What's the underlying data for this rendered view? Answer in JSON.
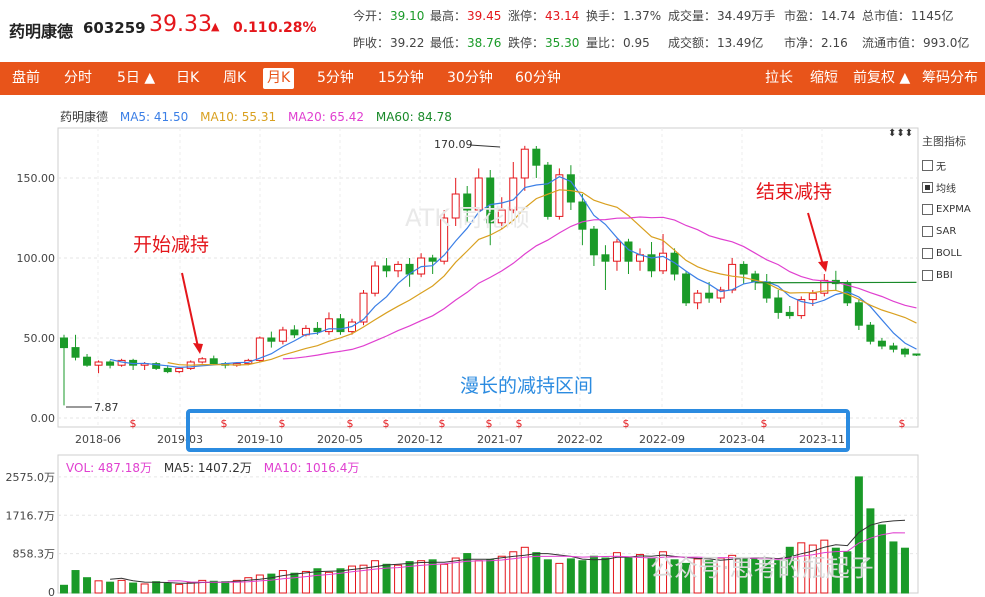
{
  "header": {
    "name": "药明康德",
    "code": "603259",
    "price": "39.33",
    "change": "0.11",
    "change_pct": "0.28%",
    "stats_row1": [
      {
        "label": "今开：",
        "value": "39.10",
        "color": "green"
      },
      {
        "label": "最高：",
        "value": "39.45",
        "color": "red"
      },
      {
        "label": "涨停：",
        "value": "43.14",
        "color": "red"
      },
      {
        "label": "换手：",
        "value": "1.37%",
        "color": ""
      },
      {
        "label": "成交量：",
        "value": "34.49万手",
        "color": ""
      },
      {
        "label": "市盈：",
        "value": "14.74",
        "color": ""
      },
      {
        "label": "总市值：",
        "value": "1145亿",
        "color": ""
      }
    ],
    "stats_row2": [
      {
        "label": "昨收：",
        "value": "39.22",
        "color": ""
      },
      {
        "label": "最低：",
        "value": "38.76",
        "color": "green"
      },
      {
        "label": "跌停：",
        "value": "35.30",
        "color": "green"
      },
      {
        "label": "量比：",
        "value": "0.95",
        "color": ""
      },
      {
        "label": "成交额：",
        "value": "13.49亿",
        "color": ""
      },
      {
        "label": "市净：",
        "value": "2.16",
        "color": ""
      },
      {
        "label": "流通市值：",
        "value": "993.0亿",
        "color": ""
      }
    ]
  },
  "tabs": {
    "left": [
      "盘前",
      "分时",
      "5日 ▲",
      "日K",
      "周K",
      "月K",
      "5分钟",
      "15分钟",
      "30分钟",
      "60分钟"
    ],
    "active": "月K",
    "right": [
      "拉长",
      "缩短",
      "前复权 ▲",
      "筹码分布"
    ]
  },
  "legend": {
    "name": "药明康德",
    "ma5": "MA5: 41.50",
    "ma10": "MA10: 55.31",
    "ma20": "MA20: 65.42",
    "ma60": "MA60: 84.78"
  },
  "vol_legend": {
    "vol": "VOL: 487.18万",
    "ma5": "MA5: 1407.2万",
    "ma10": "MA10: 1016.4万"
  },
  "side_panel": {
    "title": "主图指标",
    "options": [
      {
        "label": "无",
        "checked": false
      },
      {
        "label": "均线",
        "checked": true
      },
      {
        "label": "EXPMA",
        "checked": false
      },
      {
        "label": "SAR",
        "checked": false
      },
      {
        "label": "BOLL",
        "checked": false
      },
      {
        "label": "BBI",
        "checked": false
      }
    ]
  },
  "annotations": {
    "start": "开始减持",
    "end": "结束减持",
    "period": "漫长的减持区间",
    "high_label": "170.09",
    "low_label": "7.87"
  },
  "watermarks": {
    "center": "ATK 同花顺",
    "bottom": "公众号·思考的瓶起子"
  },
  "chart_data": {
    "type": "candlestick",
    "price_axis": {
      "ticks": [
        "150.00",
        "100.00",
        "50.00",
        "0.00"
      ],
      "values": [
        150,
        100,
        50,
        0
      ],
      "ylim": [
        0,
        180
      ]
    },
    "x_ticks": [
      "2018-06",
      "2019-03",
      "2019-10",
      "2020-05",
      "2020-12",
      "2021-07",
      "2022-02",
      "2022-09",
      "2023-04",
      "2023-11"
    ],
    "vol_axis": {
      "ticks": [
        "2575.0万",
        "1716.7万",
        "858.3万",
        "0"
      ],
      "values": [
        2575,
        1716.7,
        858.3,
        0
      ],
      "ylim": [
        0,
        2800
      ]
    },
    "candles": [
      [
        50,
        44,
        52,
        7.87,
        "d"
      ],
      [
        44,
        38,
        52,
        36,
        "d"
      ],
      [
        38,
        33,
        40,
        32,
        "d"
      ],
      [
        33,
        35,
        36,
        28,
        "u"
      ],
      [
        35,
        33,
        36,
        31,
        "d"
      ],
      [
        33,
        36,
        37,
        32,
        "u"
      ],
      [
        36,
        33,
        37,
        30,
        "d"
      ],
      [
        33,
        34,
        35,
        30,
        "u"
      ],
      [
        34,
        31,
        35,
        30,
        "d"
      ],
      [
        31,
        29,
        33,
        28,
        "d"
      ],
      [
        29,
        31,
        32,
        28,
        "u"
      ],
      [
        31,
        35,
        36,
        30,
        "u"
      ],
      [
        35,
        37,
        38,
        34,
        "u"
      ],
      [
        37,
        34,
        39,
        33,
        "d"
      ],
      [
        34,
        33,
        35,
        31,
        "d"
      ],
      [
        33,
        34,
        35,
        32,
        "u"
      ],
      [
        34,
        36,
        37,
        33,
        "u"
      ],
      [
        36,
        50,
        51,
        35,
        "u"
      ],
      [
        50,
        48,
        54,
        44,
        "d"
      ],
      [
        48,
        55,
        57,
        46,
        "u"
      ],
      [
        55,
        52,
        58,
        50,
        "d"
      ],
      [
        52,
        56,
        58,
        51,
        "u"
      ],
      [
        56,
        54,
        60,
        52,
        "d"
      ],
      [
        54,
        62,
        66,
        52,
        "u"
      ],
      [
        62,
        54,
        65,
        52,
        "d"
      ],
      [
        54,
        60,
        62,
        52,
        "u"
      ],
      [
        60,
        78,
        80,
        58,
        "u"
      ],
      [
        78,
        95,
        98,
        76,
        "u"
      ],
      [
        95,
        92,
        100,
        88,
        "d"
      ],
      [
        92,
        96,
        98,
        88,
        "u"
      ],
      [
        96,
        90,
        100,
        82,
        "d"
      ],
      [
        90,
        100,
        103,
        88,
        "u"
      ],
      [
        100,
        98,
        102,
        90,
        "d"
      ],
      [
        98,
        125,
        130,
        96,
        "u"
      ],
      [
        125,
        140,
        150,
        120,
        "u"
      ],
      [
        140,
        130,
        145,
        122,
        "d"
      ],
      [
        130,
        150,
        156,
        125,
        "u"
      ],
      [
        150,
        122,
        155,
        108,
        "d"
      ],
      [
        122,
        130,
        138,
        118,
        "u"
      ],
      [
        130,
        150,
        160,
        128,
        "u"
      ],
      [
        150,
        168,
        170.09,
        142,
        "u"
      ],
      [
        168,
        158,
        170,
        150,
        "d"
      ],
      [
        158,
        126,
        160,
        124,
        "d"
      ],
      [
        126,
        152,
        156,
        124,
        "u"
      ],
      [
        152,
        135,
        158,
        130,
        "d"
      ],
      [
        135,
        118,
        140,
        108,
        "d"
      ],
      [
        118,
        102,
        120,
        95,
        "d"
      ],
      [
        102,
        98,
        108,
        80,
        "d"
      ],
      [
        98,
        110,
        112,
        92,
        "u"
      ],
      [
        110,
        98,
        112,
        90,
        "d"
      ],
      [
        98,
        102,
        106,
        92,
        "u"
      ],
      [
        102,
        92,
        110,
        88,
        "d"
      ],
      [
        92,
        103,
        115,
        90,
        "u"
      ],
      [
        103,
        90,
        106,
        86,
        "d"
      ],
      [
        90,
        72,
        92,
        70,
        "d"
      ],
      [
        72,
        78,
        80,
        68,
        "u"
      ],
      [
        78,
        75,
        85,
        72,
        "d"
      ],
      [
        75,
        80,
        82,
        72,
        "u"
      ],
      [
        80,
        96,
        100,
        78,
        "u"
      ],
      [
        96,
        90,
        98,
        84,
        "d"
      ],
      [
        90,
        85,
        92,
        80,
        "d"
      ],
      [
        85,
        75,
        90,
        72,
        "d"
      ],
      [
        75,
        66,
        80,
        62,
        "d"
      ],
      [
        66,
        64,
        70,
        62,
        "d"
      ],
      [
        64,
        74,
        76,
        62,
        "u"
      ],
      [
        74,
        78,
        80,
        70,
        "u"
      ],
      [
        78,
        86,
        90,
        76,
        "u"
      ],
      [
        86,
        84,
        92,
        80,
        "d"
      ],
      [
        84,
        72,
        86,
        70,
        "d"
      ],
      [
        72,
        58,
        74,
        55,
        "d"
      ],
      [
        58,
        48,
        60,
        46,
        "d"
      ],
      [
        48,
        45,
        50,
        43,
        "d"
      ],
      [
        45,
        43,
        47,
        41,
        "d"
      ],
      [
        43,
        40,
        44,
        38,
        "d"
      ],
      [
        40,
        39.33,
        40,
        38.76,
        "d"
      ]
    ],
    "volume": [
      150,
      480,
      320,
      250,
      220,
      260,
      200,
      180,
      230,
      190,
      170,
      210,
      260,
      240,
      230,
      260,
      320,
      380,
      400,
      480,
      420,
      460,
      520,
      440,
      520,
      580,
      600,
      700,
      620,
      600,
      680,
      700,
      720,
      620,
      760,
      860,
      700,
      720,
      800,
      900,
      1000,
      880,
      720,
      640,
      740,
      700,
      800,
      760,
      880,
      760,
      840,
      760,
      900,
      720,
      640,
      740,
      700,
      760,
      820,
      740,
      760,
      720,
      700,
      1000,
      1100,
      1050,
      1160,
      980,
      900,
      2575,
      1860,
      1500,
      1120,
      980
    ],
    "ma": {
      "MA5": {
        "color": "#3b7fe6",
        "start": 4
      },
      "MA10": {
        "color": "#d9a020",
        "start": 9
      },
      "MA20": {
        "color": "#e040d0",
        "start": 19
      },
      "MA60": {
        "color": "#1a8a2a",
        "segment": [
          [
            60,
            84.5
          ],
          [
            74,
            84.78
          ]
        ]
      }
    }
  }
}
